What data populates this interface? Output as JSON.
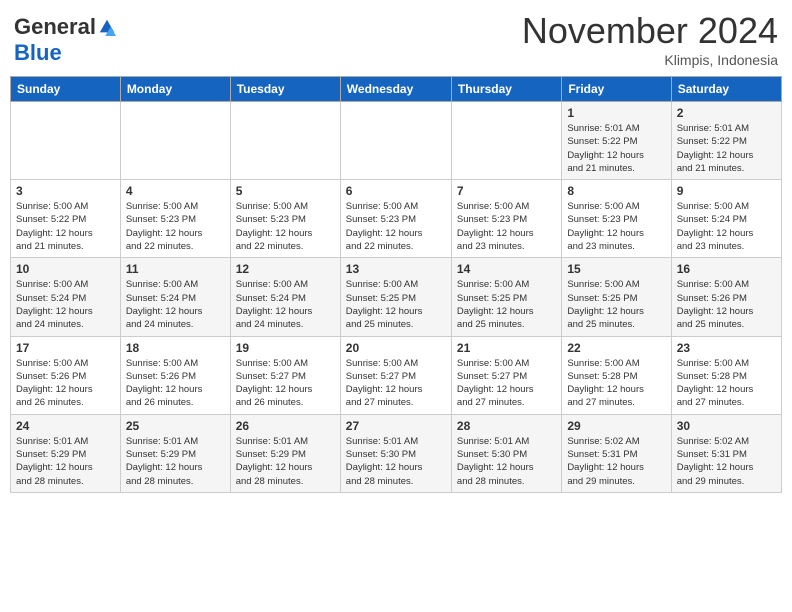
{
  "logo": {
    "general": "General",
    "blue": "Blue"
  },
  "title": "November 2024",
  "location": "Klimpis, Indonesia",
  "days_of_week": [
    "Sunday",
    "Monday",
    "Tuesday",
    "Wednesday",
    "Thursday",
    "Friday",
    "Saturday"
  ],
  "weeks": [
    [
      {
        "day": "",
        "info": ""
      },
      {
        "day": "",
        "info": ""
      },
      {
        "day": "",
        "info": ""
      },
      {
        "day": "",
        "info": ""
      },
      {
        "day": "",
        "info": ""
      },
      {
        "day": "1",
        "info": "Sunrise: 5:01 AM\nSunset: 5:22 PM\nDaylight: 12 hours\nand 21 minutes."
      },
      {
        "day": "2",
        "info": "Sunrise: 5:01 AM\nSunset: 5:22 PM\nDaylight: 12 hours\nand 21 minutes."
      }
    ],
    [
      {
        "day": "3",
        "info": "Sunrise: 5:00 AM\nSunset: 5:22 PM\nDaylight: 12 hours\nand 21 minutes."
      },
      {
        "day": "4",
        "info": "Sunrise: 5:00 AM\nSunset: 5:23 PM\nDaylight: 12 hours\nand 22 minutes."
      },
      {
        "day": "5",
        "info": "Sunrise: 5:00 AM\nSunset: 5:23 PM\nDaylight: 12 hours\nand 22 minutes."
      },
      {
        "day": "6",
        "info": "Sunrise: 5:00 AM\nSunset: 5:23 PM\nDaylight: 12 hours\nand 22 minutes."
      },
      {
        "day": "7",
        "info": "Sunrise: 5:00 AM\nSunset: 5:23 PM\nDaylight: 12 hours\nand 23 minutes."
      },
      {
        "day": "8",
        "info": "Sunrise: 5:00 AM\nSunset: 5:23 PM\nDaylight: 12 hours\nand 23 minutes."
      },
      {
        "day": "9",
        "info": "Sunrise: 5:00 AM\nSunset: 5:24 PM\nDaylight: 12 hours\nand 23 minutes."
      }
    ],
    [
      {
        "day": "10",
        "info": "Sunrise: 5:00 AM\nSunset: 5:24 PM\nDaylight: 12 hours\nand 24 minutes."
      },
      {
        "day": "11",
        "info": "Sunrise: 5:00 AM\nSunset: 5:24 PM\nDaylight: 12 hours\nand 24 minutes."
      },
      {
        "day": "12",
        "info": "Sunrise: 5:00 AM\nSunset: 5:24 PM\nDaylight: 12 hours\nand 24 minutes."
      },
      {
        "day": "13",
        "info": "Sunrise: 5:00 AM\nSunset: 5:25 PM\nDaylight: 12 hours\nand 25 minutes."
      },
      {
        "day": "14",
        "info": "Sunrise: 5:00 AM\nSunset: 5:25 PM\nDaylight: 12 hours\nand 25 minutes."
      },
      {
        "day": "15",
        "info": "Sunrise: 5:00 AM\nSunset: 5:25 PM\nDaylight: 12 hours\nand 25 minutes."
      },
      {
        "day": "16",
        "info": "Sunrise: 5:00 AM\nSunset: 5:26 PM\nDaylight: 12 hours\nand 25 minutes."
      }
    ],
    [
      {
        "day": "17",
        "info": "Sunrise: 5:00 AM\nSunset: 5:26 PM\nDaylight: 12 hours\nand 26 minutes."
      },
      {
        "day": "18",
        "info": "Sunrise: 5:00 AM\nSunset: 5:26 PM\nDaylight: 12 hours\nand 26 minutes."
      },
      {
        "day": "19",
        "info": "Sunrise: 5:00 AM\nSunset: 5:27 PM\nDaylight: 12 hours\nand 26 minutes."
      },
      {
        "day": "20",
        "info": "Sunrise: 5:00 AM\nSunset: 5:27 PM\nDaylight: 12 hours\nand 27 minutes."
      },
      {
        "day": "21",
        "info": "Sunrise: 5:00 AM\nSunset: 5:27 PM\nDaylight: 12 hours\nand 27 minutes."
      },
      {
        "day": "22",
        "info": "Sunrise: 5:00 AM\nSunset: 5:28 PM\nDaylight: 12 hours\nand 27 minutes."
      },
      {
        "day": "23",
        "info": "Sunrise: 5:00 AM\nSunset: 5:28 PM\nDaylight: 12 hours\nand 27 minutes."
      }
    ],
    [
      {
        "day": "24",
        "info": "Sunrise: 5:01 AM\nSunset: 5:29 PM\nDaylight: 12 hours\nand 28 minutes."
      },
      {
        "day": "25",
        "info": "Sunrise: 5:01 AM\nSunset: 5:29 PM\nDaylight: 12 hours\nand 28 minutes."
      },
      {
        "day": "26",
        "info": "Sunrise: 5:01 AM\nSunset: 5:29 PM\nDaylight: 12 hours\nand 28 minutes."
      },
      {
        "day": "27",
        "info": "Sunrise: 5:01 AM\nSunset: 5:30 PM\nDaylight: 12 hours\nand 28 minutes."
      },
      {
        "day": "28",
        "info": "Sunrise: 5:01 AM\nSunset: 5:30 PM\nDaylight: 12 hours\nand 28 minutes."
      },
      {
        "day": "29",
        "info": "Sunrise: 5:02 AM\nSunset: 5:31 PM\nDaylight: 12 hours\nand 29 minutes."
      },
      {
        "day": "30",
        "info": "Sunrise: 5:02 AM\nSunset: 5:31 PM\nDaylight: 12 hours\nand 29 minutes."
      }
    ]
  ]
}
